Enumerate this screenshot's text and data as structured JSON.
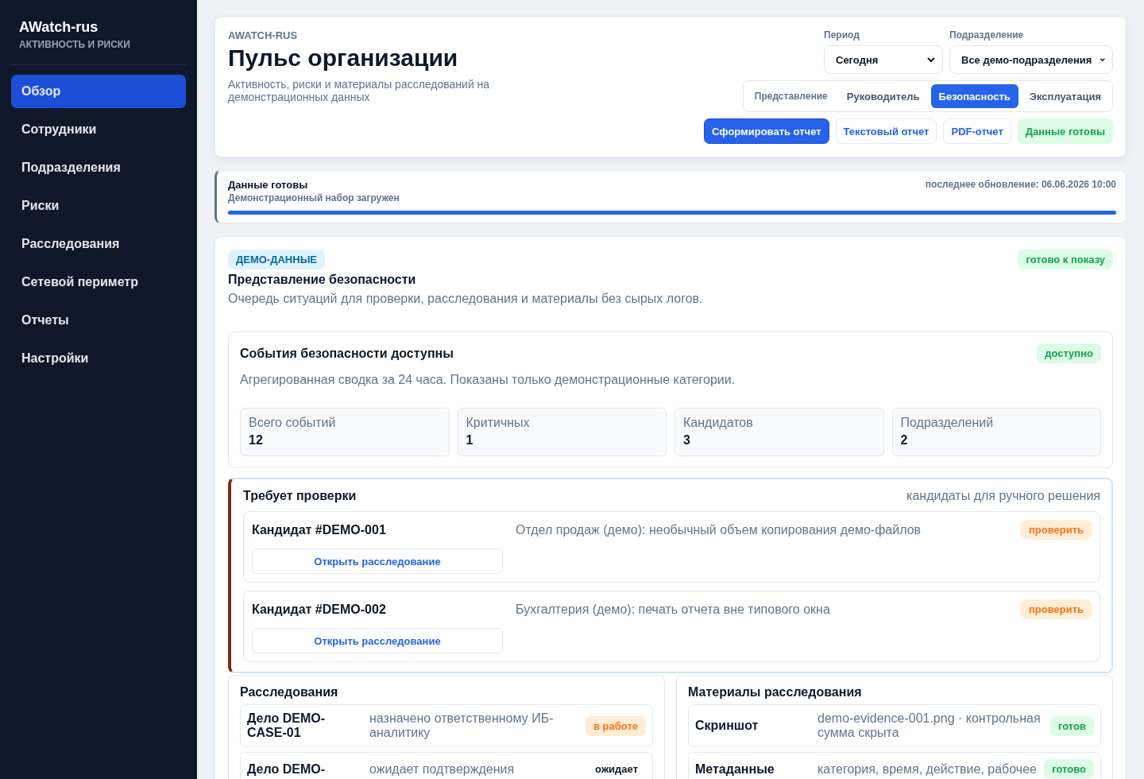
{
  "sidebar": {
    "brand": "AWatch-rus",
    "subtitle": "АКТИВНОСТЬ И РИСКИ",
    "items": [
      {
        "label": "Обзор",
        "selected": true
      },
      {
        "label": "Сотрудники",
        "selected": false
      },
      {
        "label": "Подразделения",
        "selected": false
      },
      {
        "label": "Риски",
        "selected": false
      },
      {
        "label": "Расследования",
        "selected": false
      },
      {
        "label": "Сетевой периметр",
        "selected": false
      },
      {
        "label": "Отчеты",
        "selected": false
      },
      {
        "label": "Настройки",
        "selected": false
      }
    ]
  },
  "header": {
    "eyebrow": "AWATCH-RUS",
    "title": "Пульс организации",
    "description": "Активность, риски и материалы расследований на демонстрационных данных",
    "filters": [
      {
        "label": "Период",
        "value": "Сегодня"
      },
      {
        "label": "Подразделение",
        "value": "Все демо-подразделения"
      }
    ],
    "view_label": "Представление",
    "views": [
      {
        "label": "Руководитель",
        "selected": false
      },
      {
        "label": "Безопасность",
        "selected": true
      },
      {
        "label": "Эксплуатация",
        "selected": false
      }
    ],
    "actions": [
      {
        "label": "Сформировать отчет",
        "kind": "primary"
      },
      {
        "label": "Текстовый отчет",
        "kind": "outline"
      },
      {
        "label": "PDF-отчет",
        "kind": "outline"
      },
      {
        "label": "Данные готовы",
        "kind": "status"
      }
    ]
  },
  "status": {
    "title": "Данные готовы",
    "subtitle": "Демонстрационный набор загружен",
    "updated": "последнее обновление: 06.06.2026 10:00",
    "level": 1
  },
  "section": {
    "tag": "ДЕМО-ДАННЫЕ",
    "badge": "готово к показу",
    "title": "Представление безопасности",
    "description": "Очередь ситуаций для проверки, расследования и материалы без сырых логов.",
    "events": {
      "title": "События безопасности доступны",
      "badge": "доступно",
      "description": "Агрегированная сводка за 24 часа. Показаны только демонстрационные категории.",
      "metrics": [
        {
          "label": "Всего событий",
          "value": "12"
        },
        {
          "label": "Критичных",
          "value": "1"
        },
        {
          "label": "Кандидатов",
          "value": "3"
        },
        {
          "label": "Подразделений",
          "value": "2"
        }
      ]
    },
    "review": {
      "title": "Требует проверки",
      "note": "кандидаты для ручного решения",
      "candidates": [
        {
          "title": "Кандидат #DEMO-001",
          "description": "Отдел продаж (демо): необычный объем копирования демо-файлов",
          "badge": "проверить",
          "action": "Открыть расследование"
        },
        {
          "title": "Кандидат #DEMO-002",
          "description": "Бухгалтерия (демо): печать отчета вне типового окна",
          "badge": "проверить",
          "action": "Открыть расследование"
        }
      ]
    },
    "investigations": {
      "title": "Расследования",
      "rows": [
        {
          "name": "Дело DEMO-CASE-01",
          "description": "назначено ответственному ИБ-аналитику",
          "badge": "в работе",
          "kind": "progress"
        },
        {
          "name": "Дело DEMO-",
          "description": "ожидает подтверждения",
          "badge": "ожидает",
          "kind": "plain"
        }
      ]
    },
    "materials": {
      "title": "Материалы расследования",
      "rows": [
        {
          "name": "Скриншот",
          "description": "demo-evidence-001.png · контрольная сумма скрыта",
          "badge": "готов",
          "kind": "ready"
        },
        {
          "name": "Метаданные",
          "description": "категория, время, действие, рабочее",
          "badge": "готово",
          "kind": "ready"
        }
      ]
    }
  }
}
